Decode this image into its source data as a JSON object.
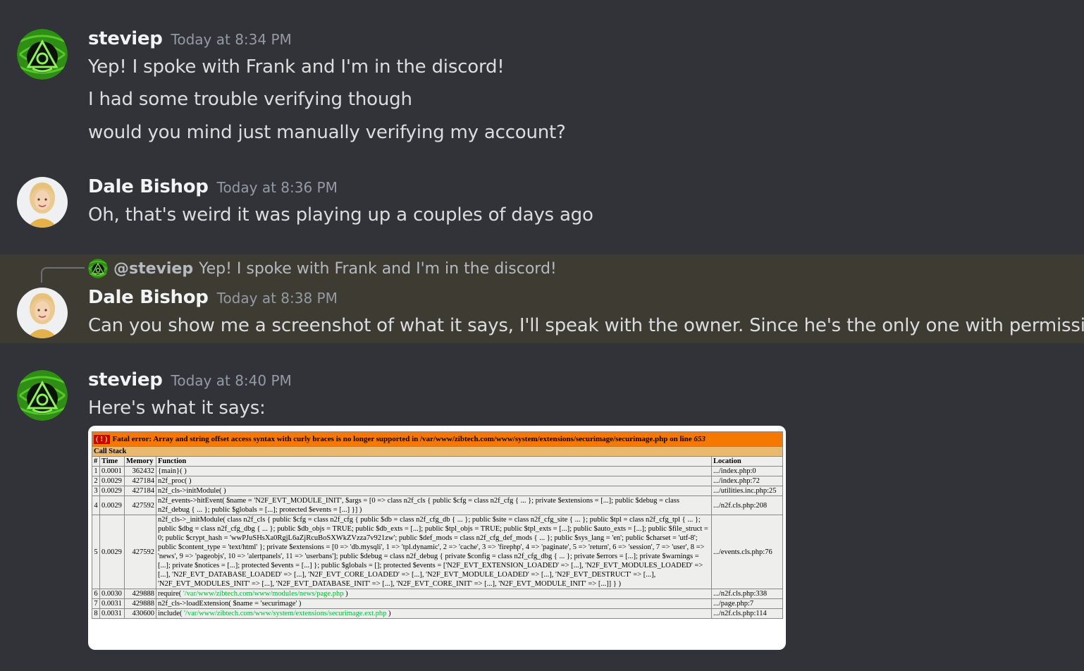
{
  "messages": [
    {
      "username": "steviep",
      "timestamp": "Today at 8:34 PM",
      "lines": [
        "Yep! I spoke with Frank and I'm in the discord!",
        "I had some trouble verifying though",
        "would you mind just manually verifying my account?"
      ]
    },
    {
      "username": "Dale Bishop",
      "timestamp": "Today at 8:36 PM",
      "lines": [
        "Oh, that's weird it was playing up a couples of days ago"
      ]
    },
    {
      "username": "Dale Bishop",
      "timestamp": "Today at 8:38 PM",
      "reply": {
        "mention": "@steviep",
        "text": "Yep! I spoke with Frank and I'm in the discord!"
      },
      "lines": [
        "Can you show me a screenshot of what it says, I'll speak with the owner. Since he's the only one with permissions"
      ]
    },
    {
      "username": "steviep",
      "timestamp": "Today at 8:40 PM",
      "lines": [
        "Here's what it says:"
      ]
    }
  ],
  "attachment": {
    "fatal_icon": "( ! )",
    "fatal_text": "Fatal error: Array and string offset access syntax with curly braces is no longer supported in /var/www/zibtech.com/www/system/extensions/securimage/securimage.php on line",
    "fatal_line": "653",
    "callstack_label": "Call Stack",
    "columns": [
      "#",
      "Time",
      "Memory",
      "Function",
      "Location"
    ],
    "rows": [
      {
        "n": "1",
        "time": "0.0001",
        "memory": "362432",
        "func": "{main}( )",
        "path": "",
        "func_end": "",
        "location": ".../index.php:0"
      },
      {
        "n": "2",
        "time": "0.0029",
        "memory": "427184",
        "func": "n2f_proc( )",
        "path": "",
        "func_end": "",
        "location": ".../index.php:72"
      },
      {
        "n": "3",
        "time": "0.0029",
        "memory": "427184",
        "func": "n2f_cls->initModule( )",
        "path": "",
        "func_end": "",
        "location": ".../utilities.inc.php:25"
      },
      {
        "n": "4",
        "time": "0.0029",
        "memory": "427592",
        "func": "n2f_events->hitEvent( $name = 'N2F_EVT_MODULE_INIT', $args = [0 => class n2f_cls { public $cfg = class n2f_cfg { ... }; private $extensions = [...]; public $debug = class n2f_debug { ... }; public $globals = [...]; protected $events = [...] }] )",
        "path": "",
        "func_end": "",
        "location": ".../n2f.cls.php:208"
      },
      {
        "n": "5",
        "time": "0.0029",
        "memory": "427592",
        "func": "n2f_cls->_initModule( class n2f_cls { public $cfg = class n2f_cfg { public $db = class n2f_cfg_db { ... }; public $site = class n2f_cfg_site { ... }; public $tpl = class n2f_cfg_tpl { ... }; public $dbg = class n2f_cfg_dbg { ... }; public $db_objs = TRUE; public $db_exts = [...]; public $tpl_objs = TRUE; public $tpl_exts = [...]; public $auto_exts = [...]; public $file_struct = 0; public $crypt_hash = 'wwPJuSHsXa0RgjL6aZjRcuBoSXWkZVzza7v921zw'; public $def_mods = class n2f_cfg_def_mods { ... }; public $sys_lang = 'en'; public $charset = 'utf-8'; public $content_type = 'text/html' }; private $extensions = [0 => 'db.mysqli', 1 => 'tpl.dynamic', 2 => 'cache', 3 => 'firephp', 4 => 'paginate', 5 => 'return', 6 => 'session', 7 => 'user', 8 => 'news', 9 => 'pageobjs', 10 => 'alertpanels', 11 => 'userbans']; public $debug = class n2f_debug { private $config = class n2f_cfg_dbg { ... }; private $errors = [...]; private $warnings = [...]; private $notices = [...]; protected $events = [...] }; public $globals = []; protected $events = ['N2F_EVT_EXTENSION_LOADED' => [...], 'N2F_EVT_MODULES_LOADED' => [...], 'N2F_EVT_DATABASE_LOADED' => [...], 'N2F_EVT_CORE_LOADED' => [...], 'N2F_EVT_MODULE_LOADED' => [...], 'N2F_EVT_DESTRUCT' => [...], 'N2F_EVT_MODULES_INIT' => [...], 'N2F_EVT_DATABASE_INIT' => [...], 'N2F_EVT_CORE_INIT' => [...], 'N2F_EVT_MODULE_INIT' => [...]] } )",
        "path": "",
        "func_end": "",
        "location": ".../events.cls.php:76"
      },
      {
        "n": "6",
        "time": "0.0030",
        "memory": "429888",
        "func": "require( ",
        "path": "'/var/www/zibtech.com/www/modules/news/page.php",
        "func_end": " )",
        "location": ".../n2f.cls.php:338"
      },
      {
        "n": "7",
        "time": "0.0031",
        "memory": "429888",
        "func": "n2f_cls->loadExtension( $name = 'securimage' )",
        "path": "",
        "func_end": "",
        "location": ".../page.php:7"
      },
      {
        "n": "8",
        "time": "0.0031",
        "memory": "430600",
        "func": "include( ",
        "path": "'/var/www/zibtech.com/www/system/extensions/securimage.ext.php",
        "func_end": " )",
        "location": ".../n2f.cls.php:114"
      }
    ]
  },
  "colors": {
    "background": "#313338",
    "highlight": "#3e3b33",
    "username": "#f2f3f5",
    "timestamp": "#949ba4"
  },
  "icons": [
    "steviep-avatar",
    "dale-avatar",
    "fatal-error-icon"
  ]
}
